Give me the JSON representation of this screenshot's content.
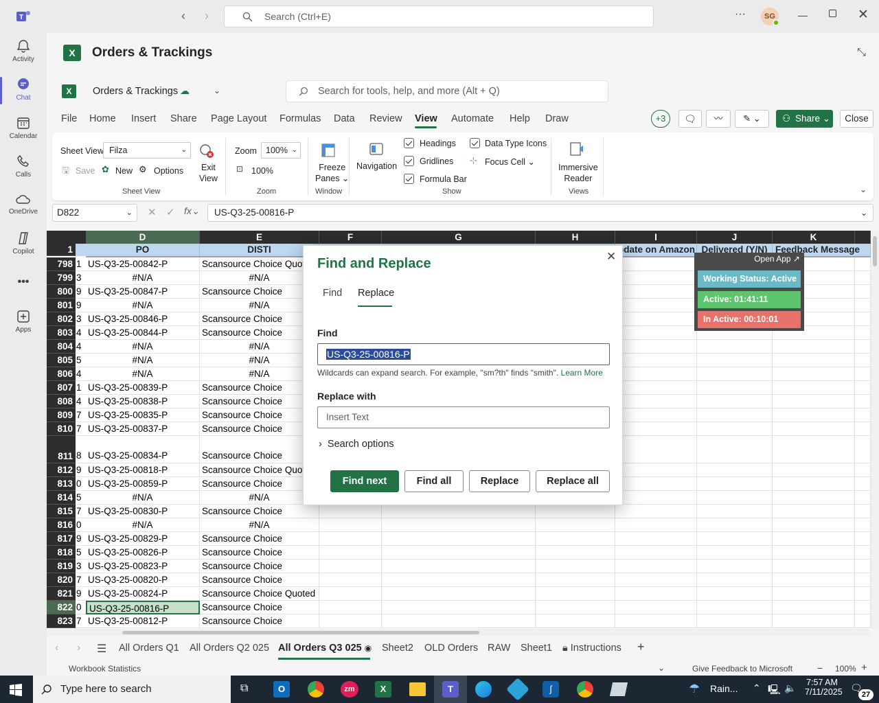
{
  "teams": {
    "search_placeholder": "Search (Ctrl+E)",
    "avatar_initials": "SG",
    "rail": [
      {
        "label": "Activity",
        "icon": "bell-icon"
      },
      {
        "label": "Chat",
        "icon": "chat-icon"
      },
      {
        "label": "Calendar",
        "icon": "calendar-icon"
      },
      {
        "label": "Calls",
        "icon": "phone-icon"
      },
      {
        "label": "OneDrive",
        "icon": "cloud-icon"
      },
      {
        "label": "Copilot",
        "icon": "copilot-icon"
      },
      {
        "label": "Apps",
        "icon": "add-apps-icon"
      }
    ]
  },
  "app": {
    "title": "Orders & Trackings",
    "file_name": "Orders & Trackings",
    "search_placeholder": "Search for tools, help, and more (Alt + Q)",
    "menu": [
      "File",
      "Home",
      "Insert",
      "Share",
      "Page Layout",
      "Formulas",
      "Data",
      "Review",
      "View",
      "Automate",
      "Help",
      "Draw"
    ],
    "active_menu": "View",
    "collaborators": "+3",
    "share_label": "Share",
    "close_label": "Close"
  },
  "ribbon": {
    "sheet_view_label": "Sheet View",
    "sheet_view_value": "Filza",
    "save": "Save",
    "new": "New",
    "options": "Options",
    "exit_view": [
      "Exit",
      "View"
    ],
    "sheet_view_group": "Sheet View",
    "zoom_label": "Zoom",
    "zoom_value": "100%",
    "zoom_100": "100%",
    "zoom_group": "Zoom",
    "freeze": [
      "Freeze",
      "Panes"
    ],
    "window_group": "Window",
    "navigation": "Navigation",
    "headings": "Headings",
    "gridlines": "Gridlines",
    "formula_bar": "Formula Bar",
    "data_type_icons": "Data Type Icons",
    "focus_cell": "Focus Cell",
    "show_group": "Show",
    "immersive": [
      "Immersive",
      "Reader"
    ],
    "views_group": "Views"
  },
  "formula": {
    "name_box": "D822",
    "value": "US-Q3-25-00816-P"
  },
  "grid": {
    "columns": [
      "D",
      "E",
      "F",
      "G",
      "H",
      "I",
      "J",
      "K"
    ],
    "header_row": {
      "num": "1",
      "D": "PO",
      "E": "DISTI",
      "I": "pdate on Amazon",
      "J": "Delivered (Y/N)",
      "K": "Feedback Message"
    },
    "rows": [
      {
        "num": "798",
        "c": "1",
        "d": "US-Q3-25-00842-P",
        "e": "Scansource Choice Quote"
      },
      {
        "num": "799",
        "c": "3",
        "d": "#N/A",
        "e": "#N/A"
      },
      {
        "num": "800",
        "c": "9",
        "d": "US-Q3-25-00847-P",
        "e": "Scansource Choice"
      },
      {
        "num": "801",
        "c": "9",
        "d": "#N/A",
        "e": "#N/A"
      },
      {
        "num": "802",
        "c": "3",
        "d": "US-Q3-25-00846-P",
        "e": "Scansource Choice"
      },
      {
        "num": "803",
        "c": "4",
        "d": "US-Q3-25-00844-P",
        "e": "Scansource Choice"
      },
      {
        "num": "804",
        "c": "4",
        "d": "#N/A",
        "e": "#N/A"
      },
      {
        "num": "805",
        "c": "5",
        "d": "#N/A",
        "e": "#N/A"
      },
      {
        "num": "806",
        "c": "4",
        "d": "#N/A",
        "e": "#N/A"
      },
      {
        "num": "807",
        "c": "1",
        "d": "US-Q3-25-00839-P",
        "e": "Scansource Choice"
      },
      {
        "num": "808",
        "c": "4",
        "d": "US-Q3-25-00838-P",
        "e": "Scansource Choice"
      },
      {
        "num": "809",
        "c": "7",
        "d": "US-Q3-25-00835-P",
        "e": "Scansource Choice"
      },
      {
        "num": "810",
        "c": "7",
        "d": "US-Q3-25-00837-P",
        "e": "Scansource Choice"
      },
      {
        "num": "811",
        "c": "8",
        "d": "US-Q3-25-00834-P",
        "e": "Scansource Choice"
      },
      {
        "num": "812",
        "c": "9",
        "d": "US-Q3-25-00818-P",
        "e": "Scansource Choice Quote"
      },
      {
        "num": "813",
        "c": "0",
        "d": "US-Q3-25-00859-P",
        "e": "Scansource Choice"
      },
      {
        "num": "814",
        "c": "5",
        "d": "#N/A",
        "e": "#N/A"
      },
      {
        "num": "815",
        "c": "7",
        "d": "US-Q3-25-00830-P",
        "e": "Scansource Choice"
      },
      {
        "num": "816",
        "c": "0",
        "d": "#N/A",
        "e": "#N/A"
      },
      {
        "num": "817",
        "c": "9",
        "d": "US-Q3-25-00829-P",
        "e": "Scansource Choice"
      },
      {
        "num": "818",
        "c": "5",
        "d": "US-Q3-25-00826-P",
        "e": "Scansource Choice"
      },
      {
        "num": "819",
        "c": "3",
        "d": "US-Q3-25-00823-P",
        "e": "Scansource Choice"
      },
      {
        "num": "820",
        "c": "7",
        "d": "US-Q3-25-00820-P",
        "e": "Scansource Choice"
      },
      {
        "num": "821",
        "c": "9",
        "d": "US-Q3-25-00824-P",
        "e": "Scansource Choice Quoted"
      },
      {
        "num": "822",
        "c": "0",
        "d": "US-Q3-25-00816-P",
        "e": "Scansource Choice"
      },
      {
        "num": "823",
        "c": "7",
        "d": "US-Q3-25-00812-P",
        "e": "Scansource Choice"
      }
    ],
    "selected_row": "822"
  },
  "dialog": {
    "title": "Find and Replace",
    "tab_find": "Find",
    "tab_replace": "Replace",
    "find_label": "Find",
    "find_value": "US-Q3-25-00816-P",
    "hint": "Wildcards can expand search. For example, \"sm?th\" finds \"smith\".",
    "learn_more": "Learn More",
    "replace_label": "Replace with",
    "replace_placeholder": "Insert Text",
    "search_options": "Search options",
    "btn_find_next": "Find next",
    "btn_find_all": "Find all",
    "btn_replace": "Replace",
    "btn_replace_all": "Replace all"
  },
  "widget": {
    "open_app": "Open App ↗",
    "status": "Working Status: Active",
    "active": "Active: 01:41:11",
    "inactive": "In Active: 00:10:01",
    "colors": {
      "status": "#6bb8c7",
      "active": "#5ec46e",
      "inactive": "#e8726a"
    }
  },
  "sheets": {
    "tabs": [
      "All Orders Q1",
      "All Orders Q2 025",
      "All Orders Q3 025",
      "Sheet2",
      "OLD Orders",
      "RAW",
      "Sheet1",
      "Instructions"
    ],
    "active": "All Orders Q3 025"
  },
  "status": {
    "workbook_stats": "Workbook Statistics",
    "feedback": "Give Feedback to Microsoft",
    "zoom": "100%"
  },
  "taskbar": {
    "search_placeholder": "Type here to search",
    "weather": "Rain...",
    "time": "7:57 AM",
    "date": "7/11/2025",
    "notifications": "27"
  },
  "colors": {
    "excel_green": "#217346",
    "teams_purple": "#5b5fc7",
    "selection_green": "#c6e0cc"
  }
}
